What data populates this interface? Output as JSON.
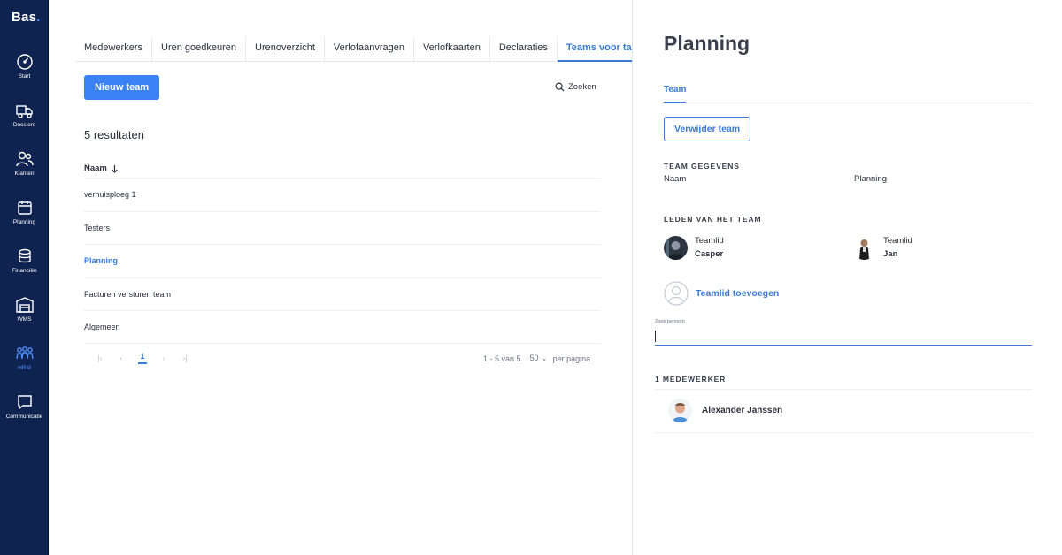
{
  "app": {
    "logo": "Bas",
    "logo_dot": "."
  },
  "sidebar": {
    "items": [
      {
        "label": "Start",
        "icon": "speedometer-icon"
      },
      {
        "label": "Dossiers",
        "icon": "truck-icon"
      },
      {
        "label": "Klanten",
        "icon": "users-icon"
      },
      {
        "label": "Planning",
        "icon": "calendar-icon"
      },
      {
        "label": "Financiën",
        "icon": "coins-icon"
      },
      {
        "label": "WMS",
        "icon": "warehouse-icon"
      },
      {
        "label": "HRM",
        "icon": "people-icon",
        "active": true
      },
      {
        "label": "Communicatie",
        "icon": "chat-icon"
      }
    ]
  },
  "tabs": [
    "Medewerkers",
    "Uren goedkeuren",
    "Urenoverzicht",
    "Verlofaanvragen",
    "Verlofkaarten",
    "Declaraties",
    "Teams voor taken"
  ],
  "active_tab": "Teams voor taken",
  "list": {
    "new_button": "Nieuw team",
    "search_label": "Zoeken",
    "results": "5 resultaten",
    "column": "Naam",
    "rows": [
      "verhuisploeg 1",
      "Testers",
      "Planning",
      "Facturen versturen team",
      "Algemeen"
    ],
    "selected_row": "Planning",
    "pager": {
      "current_page": "1",
      "range": "1 - 5 van 5",
      "per_page": "50",
      "per_page_label": "per pagina"
    }
  },
  "panel": {
    "title": "Planning",
    "tab": "Team",
    "delete_button": "Verwijder team",
    "details_title": "TEAM GEGEVENS",
    "name_label": "Naam",
    "name_value": "Planning",
    "members_title": "LEDEN VAN HET TEAM",
    "members": [
      {
        "role": "Teamlid",
        "name": "Casper"
      },
      {
        "role": "Teamlid",
        "name": "Jan"
      }
    ],
    "add_member": "Teamlid toevoegen",
    "search_field_label": "Zoek persoon",
    "search_field_value": "",
    "employee_count": "1 MEDEWERKER",
    "employees": [
      "Alexander Janssen"
    ]
  },
  "colors": {
    "sidebar": "#0f2350",
    "accent": "#3b82f6",
    "link": "#3a7bd5",
    "text": "#2b2f3a"
  }
}
